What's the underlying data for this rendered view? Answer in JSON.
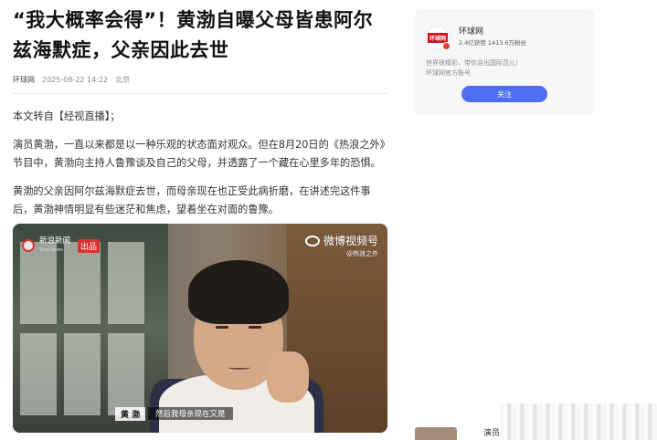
{
  "article": {
    "title": "“我大概率会得”！黄渤自曝父母皆患阿尔兹海默症，父亲因此去世",
    "source": "环球网",
    "datetime": "2025-08-22 14:22",
    "location": "北京",
    "paragraphs": [
      "本文转自【经视直播】；",
      "演员黄渤，一直以来都是以一种乐观的状态面对观众。但在8月20日的《热浪之外》节目中，黄渤向主持人鲁豫谈及自己的父母，并透露了一个藏在心里多年的恐惧。",
      "黄渤的父亲因阿尔兹海默症去世，而母亲现在也正受此病折磨，在讲述完这件事后，黄渤神情明显有些迷茫和焦虑，望着坐在对面的鲁豫。"
    ]
  },
  "video": {
    "left_watermark": "新浪新闻",
    "left_watermark_sub": "Sina News",
    "left_tag": "出品",
    "right_watermark": "微博视频号",
    "right_watermark_sub": "@热浪之外",
    "subtitle_name": "黄  渤",
    "subtitle_text": "然后我母亲现在又是"
  },
  "sidebar": {
    "avatar_text": "环球网",
    "name": "环球网",
    "stats": "2.4亿获赞 1413.6万粉丝",
    "desc_line1": "世界很精彩，带你浴出国际范儿!",
    "desc_line2": "环球网官方账号",
    "follow_label": "关注",
    "bottom_item_text": "演员"
  }
}
